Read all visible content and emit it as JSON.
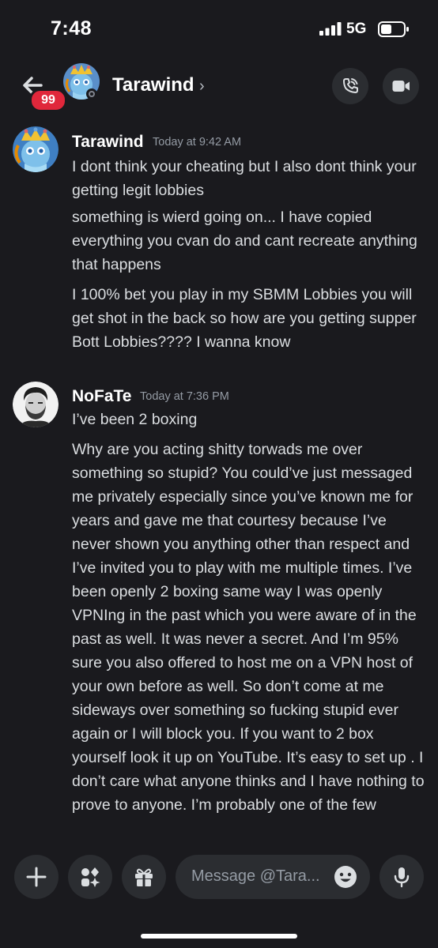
{
  "status_bar": {
    "time": "7:48",
    "network": "5G"
  },
  "header": {
    "title": "Tarawind",
    "chevron": "›",
    "unread_count": "99",
    "icons": {
      "back": "back-arrow-icon",
      "call": "phone-call-icon",
      "video": "video-camera-icon"
    }
  },
  "messages": [
    {
      "author": "Tarawind",
      "timestamp": "Today at 9:42 AM",
      "lines": [
        "I dont think your cheating but I also dont think your getting legit lobbies",
        "something is wierd going on... I have copied everything you cvan do and cant recreate anything that happens",
        "I 100% bet you play in my SBMM Lobbies you will get shot in the back so how are you getting supper Bott Lobbies???? I wanna know"
      ]
    },
    {
      "author": "NoFaTe",
      "timestamp": "Today at 7:36 PM",
      "lines": [
        "I’ve been 2 boxing",
        "Why are you acting shitty torwads me over something so stupid? You could’ve just messaged me privately especially since you’ve known me for years and gave me that courtesy because I’ve never shown you anything other than respect and I’ve invited you to play with me multiple times. I’ve been openly 2 boxing same way I was openly VPNIng in the past which you were aware of in the past as well. It was never a secret. And I’m 95% sure you also offered to host me on a VPN host of your own before as well. So don’t come at me sideways over something so fucking stupid ever again or I will block you. If you want to 2 box yourself look it up on YouTube. It’s easy to set up . I don’t care what anyone thinks and I have nothing to prove to anyone. I’m probably one of the few"
      ]
    }
  ],
  "input": {
    "placeholder": "Message @Tara..."
  },
  "colors": {
    "background": "#1a1a1e",
    "badge": "#e0273b",
    "button_bg": "#2b2d31",
    "text": "#dbdee1",
    "muted": "#949ba4"
  }
}
